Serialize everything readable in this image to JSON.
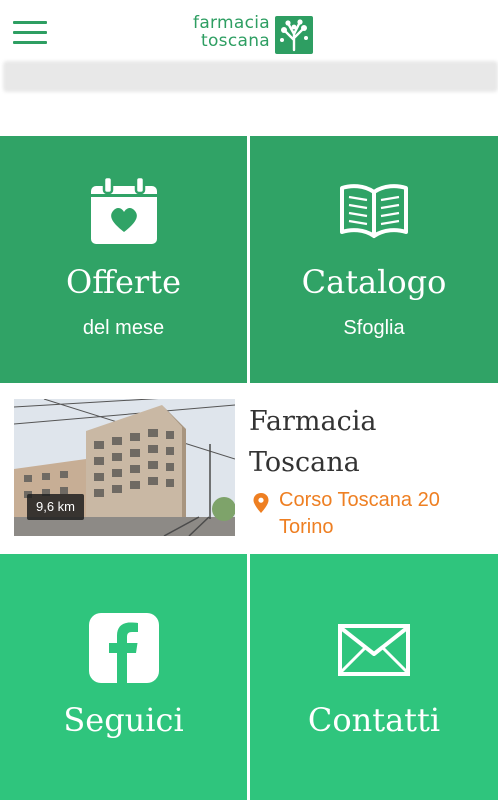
{
  "header": {
    "logo_line1": "farmacia",
    "logo_line2": "toscana",
    "menu_icon": "hamburger-menu-icon",
    "brand_color": "#2e9e62"
  },
  "tiles": {
    "offers": {
      "title": "Offerte",
      "subtitle": "del mese",
      "icon": "calendar-heart-icon",
      "color": "#30a366"
    },
    "catalog": {
      "title": "Catalogo",
      "subtitle": "Sfoglia",
      "icon": "open-book-icon",
      "color": "#30a366"
    },
    "follow": {
      "title": "Seguici",
      "icon": "facebook-icon",
      "color": "#2fc57d"
    },
    "contact": {
      "title": "Contatti",
      "icon": "envelope-icon",
      "color": "#2fc57d"
    }
  },
  "store": {
    "name_line1": "Farmacia",
    "name_line2": "Toscana",
    "address_line1": "Corso Toscana 20",
    "address_line2": "Torino",
    "distance": "9,6 km",
    "address_color": "#ee7f22",
    "pin_icon": "location-pin-icon"
  }
}
